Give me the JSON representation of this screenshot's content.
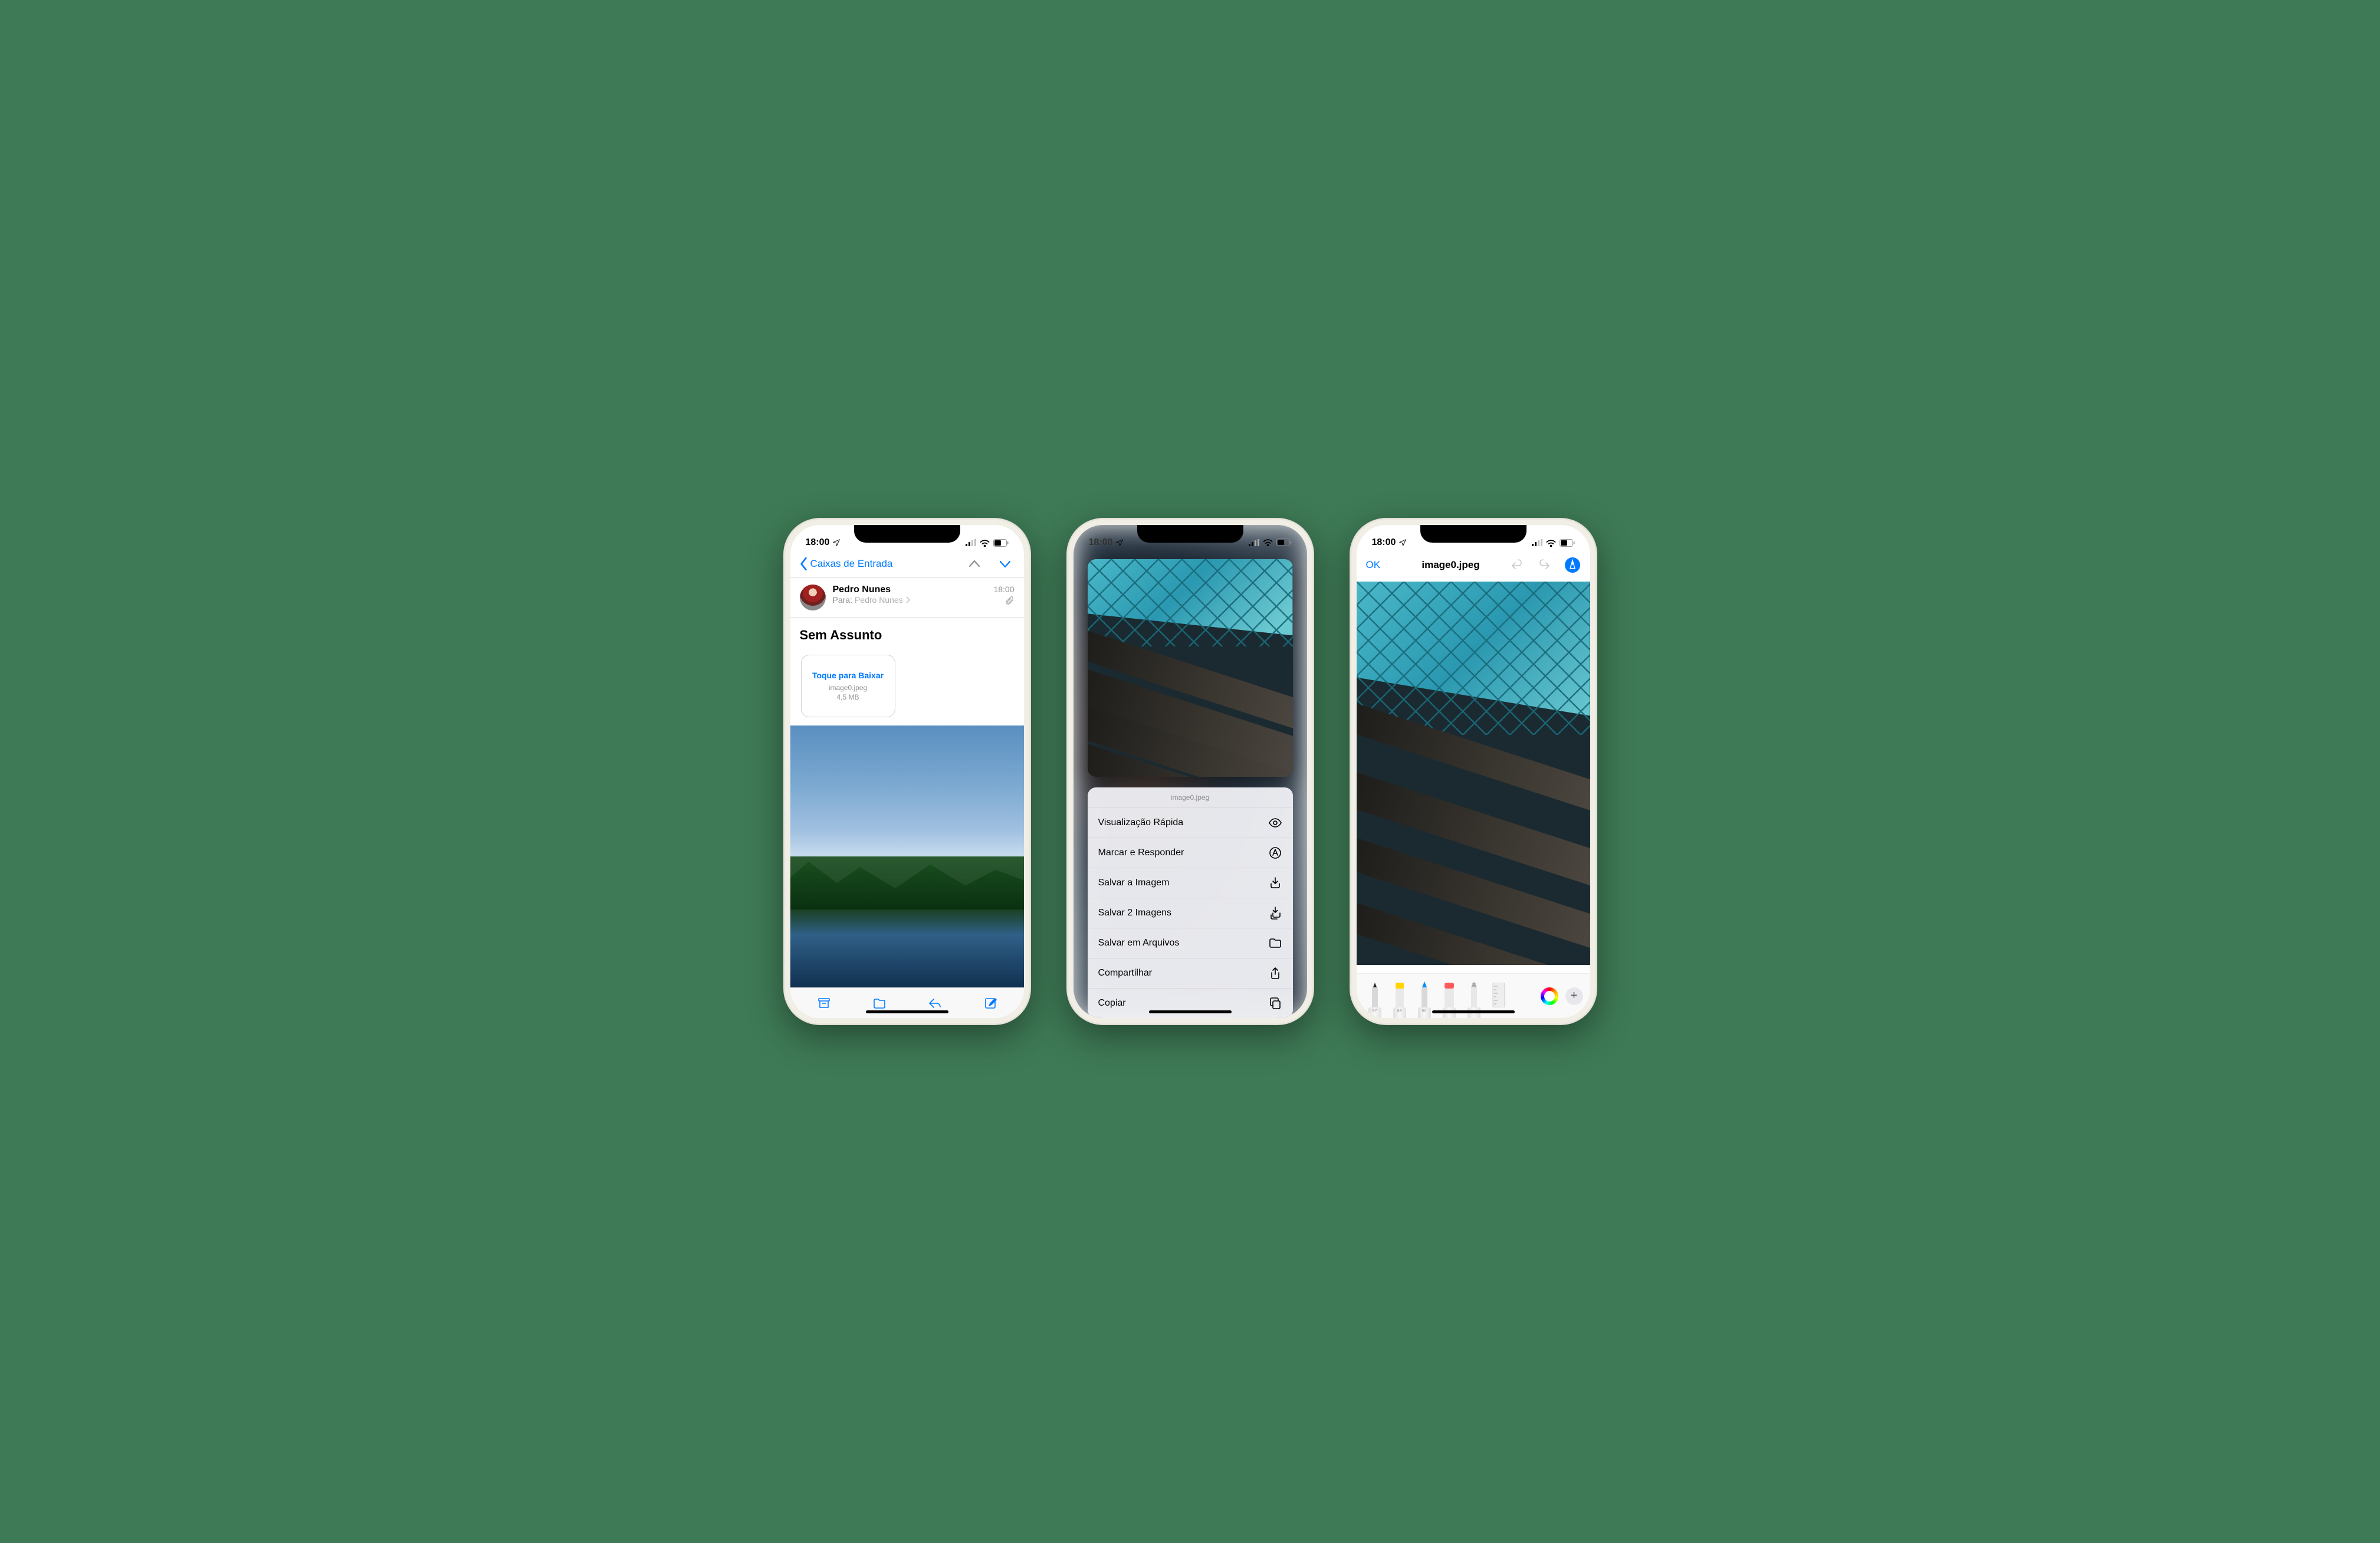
{
  "status": {
    "time": "18:00"
  },
  "phone1": {
    "back_label": "Caixas de Entrada",
    "sender": "Pedro Nunes",
    "to_prefix": "Para:",
    "to_name": "Pedro Nunes",
    "time": "18:00",
    "subject": "Sem Assunto",
    "attachment": {
      "download": "Toque para Baixar",
      "filename": "image0.jpeg",
      "size": "4,5 MB"
    }
  },
  "phone2": {
    "menu_title": "image0.jpeg",
    "items": [
      {
        "label": "Visualização Rápida",
        "icon": "eye"
      },
      {
        "label": "Marcar e Responder",
        "icon": "markup"
      },
      {
        "label": "Salvar a Imagem",
        "icon": "save-image"
      },
      {
        "label": "Salvar 2 Imagens",
        "icon": "save-images"
      },
      {
        "label": "Salvar em Arquivos",
        "icon": "folder"
      },
      {
        "label": "Compartilhar",
        "icon": "share"
      },
      {
        "label": "Copiar",
        "icon": "copy"
      }
    ]
  },
  "phone3": {
    "ok": "OK",
    "title": "image0.jpeg",
    "tool_labels": [
      "97",
      "88",
      "50",
      "",
      ""
    ]
  }
}
